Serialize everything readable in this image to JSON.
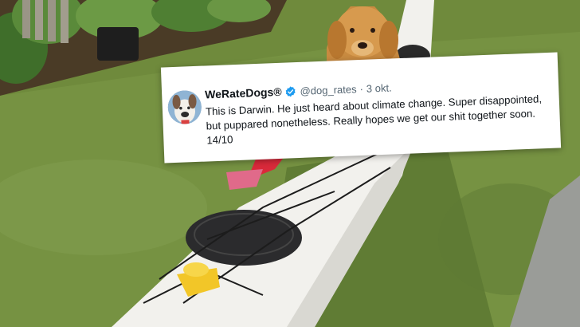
{
  "tweet": {
    "display_name": "WeRateDogs®",
    "handle": "@dog_rates",
    "separator": "·",
    "date": "3 okt.",
    "text": "This is Darwin. He just heard about climate change. Super disappointed, but puppared nonetheless. Really hopes we get our shit together soon. 14/10",
    "verified_icon": "verified-badge-icon",
    "colors": {
      "verified": "#1d9bf0",
      "handle": "#536471",
      "text": "#0f1419"
    }
  },
  "photo": {
    "subject": "golden-retriever-dog",
    "elements": [
      "kayak",
      "lawn",
      "hedge",
      "fence",
      "sidewalk"
    ]
  }
}
